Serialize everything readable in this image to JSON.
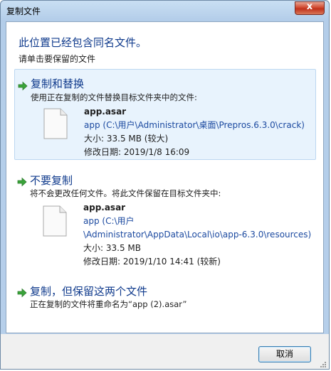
{
  "window": {
    "title": "复制文件",
    "close_label": "x"
  },
  "heading": "此位置已经包含同名文件。",
  "subheading": "请单击要保留的文件",
  "options": [
    {
      "title": "复制和替换",
      "description": "使用正在复制的文件替换目标文件夹中的文件:",
      "file": {
        "name": "app.asar",
        "path_lines": [
          "app (C:\\用户\\Administrator\\桌面\\Prepros.6.3.0\\crack)"
        ],
        "size": "大小: 33.5 MB (较大)",
        "modified": "修改日期: 2019/1/8 16:09"
      }
    },
    {
      "title": "不要复制",
      "description": "将不会更改任何文件。将此文件保留在目标文件夹中:",
      "file": {
        "name": "app.asar",
        "path_lines": [
          "app (C:\\用户",
          "\\Administrator\\AppData\\Local\\io\\app-6.3.0\\resources)"
        ],
        "size": "大小: 33.5 MB",
        "modified": "修改日期: 2019/1/10 14:41 (较新)"
      }
    },
    {
      "title": "复制，但保留这两个文件",
      "description": "正在复制的文件将重命名为“app (2).asar”"
    }
  ],
  "cancel_label": "取消"
}
